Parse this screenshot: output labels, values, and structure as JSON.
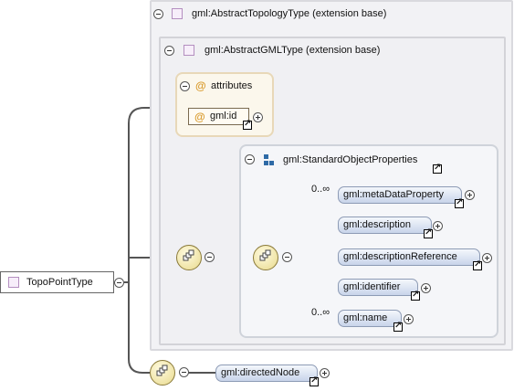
{
  "root": {
    "label": "TopoPointType"
  },
  "extension_outer": {
    "label": "gml:AbstractTopologyType (extension base)"
  },
  "extension_inner": {
    "label": "gml:AbstractGMLType (extension base)"
  },
  "attributes": {
    "label": "attributes",
    "items": [
      {
        "label": "gml:id"
      }
    ]
  },
  "standard_props": {
    "label": "gml:StandardObjectProperties",
    "elements": [
      {
        "label": "gml:metaDataProperty",
        "occurrence": "0..∞"
      },
      {
        "label": "gml:description",
        "occurrence": ""
      },
      {
        "label": "gml:descriptionReference",
        "occurrence": ""
      },
      {
        "label": "gml:identifier",
        "occurrence": ""
      },
      {
        "label": "gml:name",
        "occurrence": "0..∞"
      }
    ]
  },
  "directed_node": {
    "label": "gml:directedNode"
  },
  "colors": {
    "element_fill": "#c8d4ea",
    "attribute_group_fill": "#fbf7ec",
    "connector": "#555555"
  }
}
